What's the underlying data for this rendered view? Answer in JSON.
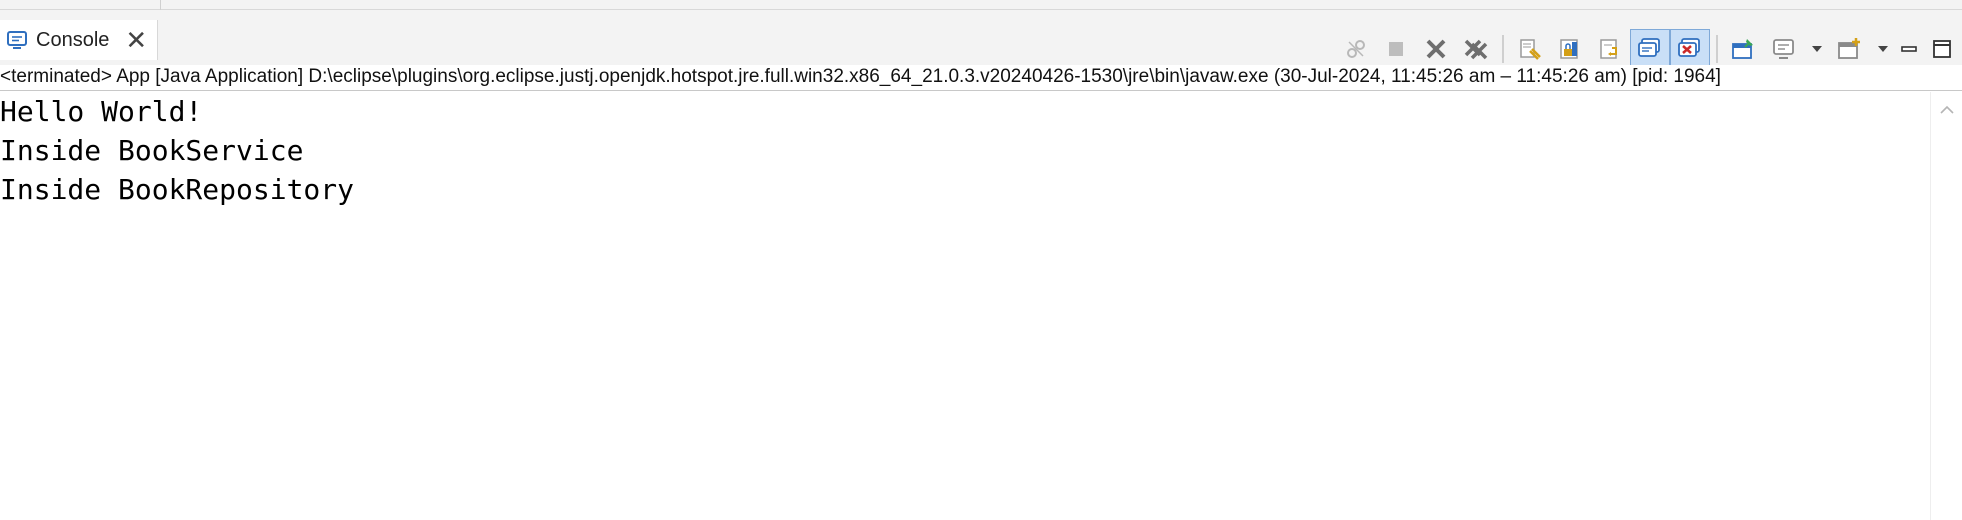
{
  "tab": {
    "title": "Console",
    "icon": "console-icon",
    "close_glyph": "✕"
  },
  "toolbar": {
    "buttons": [
      {
        "name": "disconnect-icon",
        "enabled": false
      },
      {
        "name": "terminate-icon",
        "enabled": false
      },
      {
        "name": "remove-launch-icon",
        "enabled": true
      },
      {
        "name": "remove-all-terminated-icon",
        "enabled": true
      },
      {
        "name": "clear-console-icon",
        "enabled": true
      },
      {
        "name": "scroll-lock-icon",
        "enabled": true
      },
      {
        "name": "word-wrap-icon",
        "enabled": true
      },
      {
        "name": "show-on-stdout-icon",
        "pressed": true
      },
      {
        "name": "show-on-stderr-icon",
        "pressed": true
      },
      {
        "name": "pin-console-icon",
        "enabled": true
      },
      {
        "name": "display-selected-console-icon",
        "enabled": true
      },
      {
        "name": "open-console-icon",
        "enabled": true
      },
      {
        "name": "view-menu-icon",
        "enabled": true
      },
      {
        "name": "minimize-icon",
        "enabled": true
      },
      {
        "name": "maximize-icon",
        "enabled": true
      }
    ]
  },
  "status": {
    "text": "<terminated> App [Java Application] D:\\eclipse\\plugins\\org.eclipse.justj.openjdk.hotspot.jre.full.win32.x86_64_21.0.3.v20240426-1530\\jre\\bin\\javaw.exe  (30-Jul-2024, 11:45:26 am – 11:45:26 am) [pid: 1964]"
  },
  "console": {
    "lines": [
      "Hello World!",
      "Inside BookService",
      "Inside BookRepository"
    ]
  },
  "colors": {
    "pressed_bg": "#c9dff7",
    "icon_blue": "#2f6fbf",
    "icon_gray": "#9a9a9a",
    "icon_gold": "#d4a017",
    "icon_red": "#cc2a2a",
    "icon_green": "#3aa655"
  }
}
